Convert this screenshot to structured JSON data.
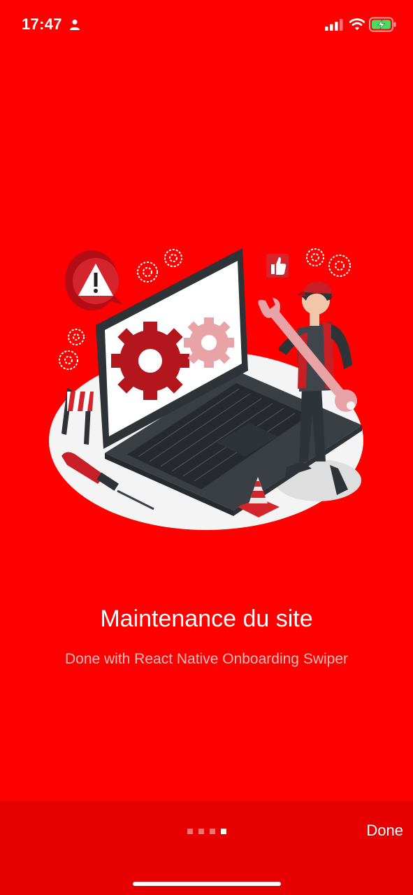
{
  "status": {
    "time": "17:47",
    "icons": [
      "person-icon",
      "signal-icon",
      "wifi-icon",
      "battery-charging-icon"
    ]
  },
  "onboarding": {
    "title": "Maintenance du site",
    "subtitle": "Done with React Native Onboarding Swiper",
    "illustration": "maintenance-laptop-illustration"
  },
  "pagination": {
    "total": 4,
    "active_index": 3
  },
  "footer": {
    "done_label": "Done"
  },
  "colors": {
    "background": "#fe0000",
    "bottom_bar": "#e60000"
  }
}
